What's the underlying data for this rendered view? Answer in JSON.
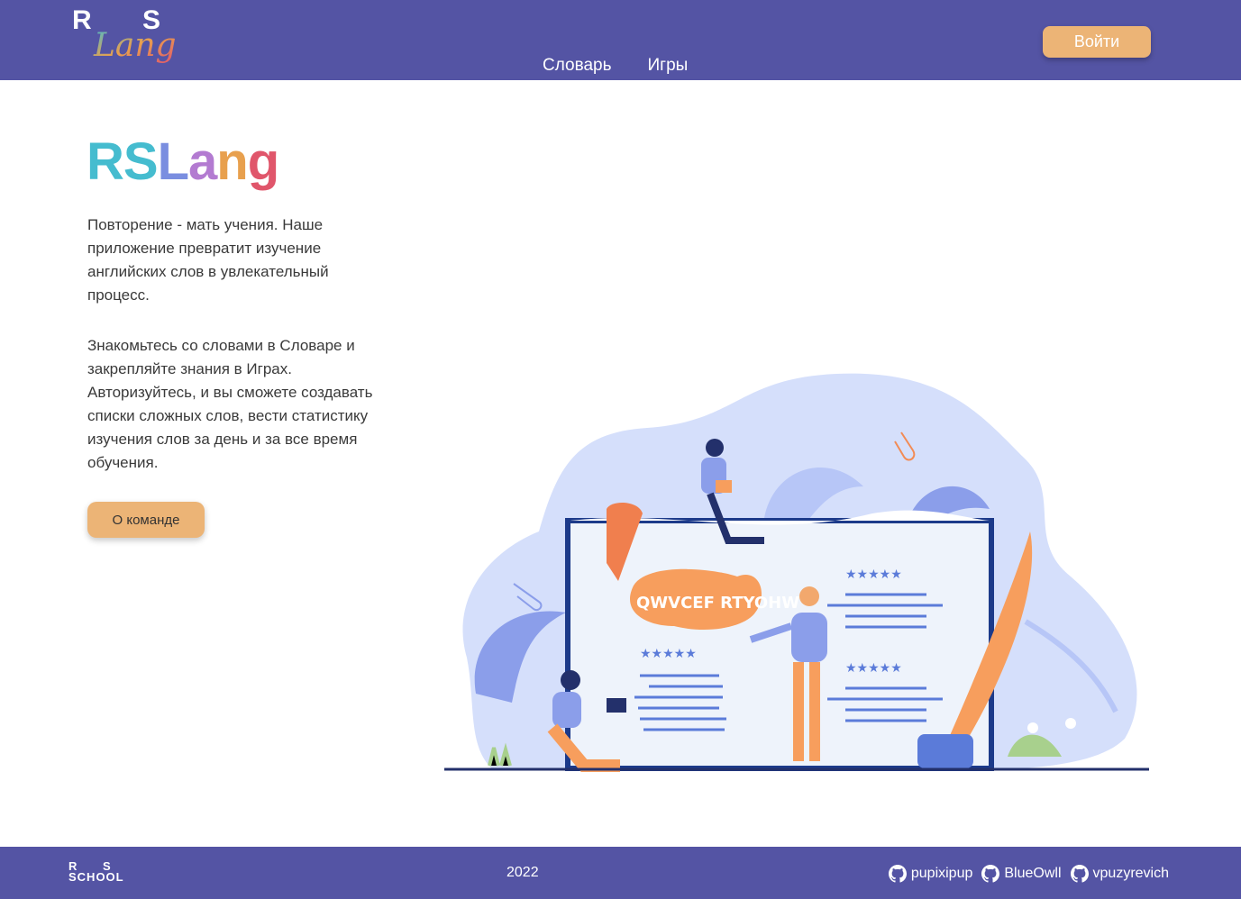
{
  "header": {
    "logo_r": "R",
    "logo_s": "S",
    "logo_script": "Lang",
    "nav": [
      {
        "label": "Словарь"
      },
      {
        "label": "Игры"
      }
    ],
    "login_label": "Войти"
  },
  "main": {
    "title_letters": [
      "R",
      "S",
      "L",
      "a",
      "n",
      "g"
    ],
    "title_colors": [
      "#45bccf",
      "#45bccf",
      "#7a8ee0",
      "#b37bd1",
      "#e8a04e",
      "#e0566b"
    ],
    "paragraph1": "Повторение - мать учения. Наше приложение превратит изучение английских слов в увлекательный процесс.",
    "paragraph2": "Знакомьтесь со словами в Словаре и закрепляйте знания в Играх. Авторизуйтесь, и вы сможете создавать списки сложных слов, вести статистику изучения слов за день и за все время обучения.",
    "about_label": "О команде",
    "speech_letters": "QWVCEF RTYOHW"
  },
  "footer": {
    "school_row1_r": "R",
    "school_row1_s": "S",
    "school_row2": "SCHOOL",
    "year": "2022",
    "authors": [
      {
        "name": "pupixipup",
        "icon": "github-icon"
      },
      {
        "name": "BlueOwll",
        "icon": "github-icon"
      },
      {
        "name": "vpuzyrevich",
        "icon": "github-icon"
      }
    ]
  },
  "colors": {
    "header_bg": "#5454a4",
    "accent": "#ecb476",
    "blob": "#d5dffb"
  }
}
